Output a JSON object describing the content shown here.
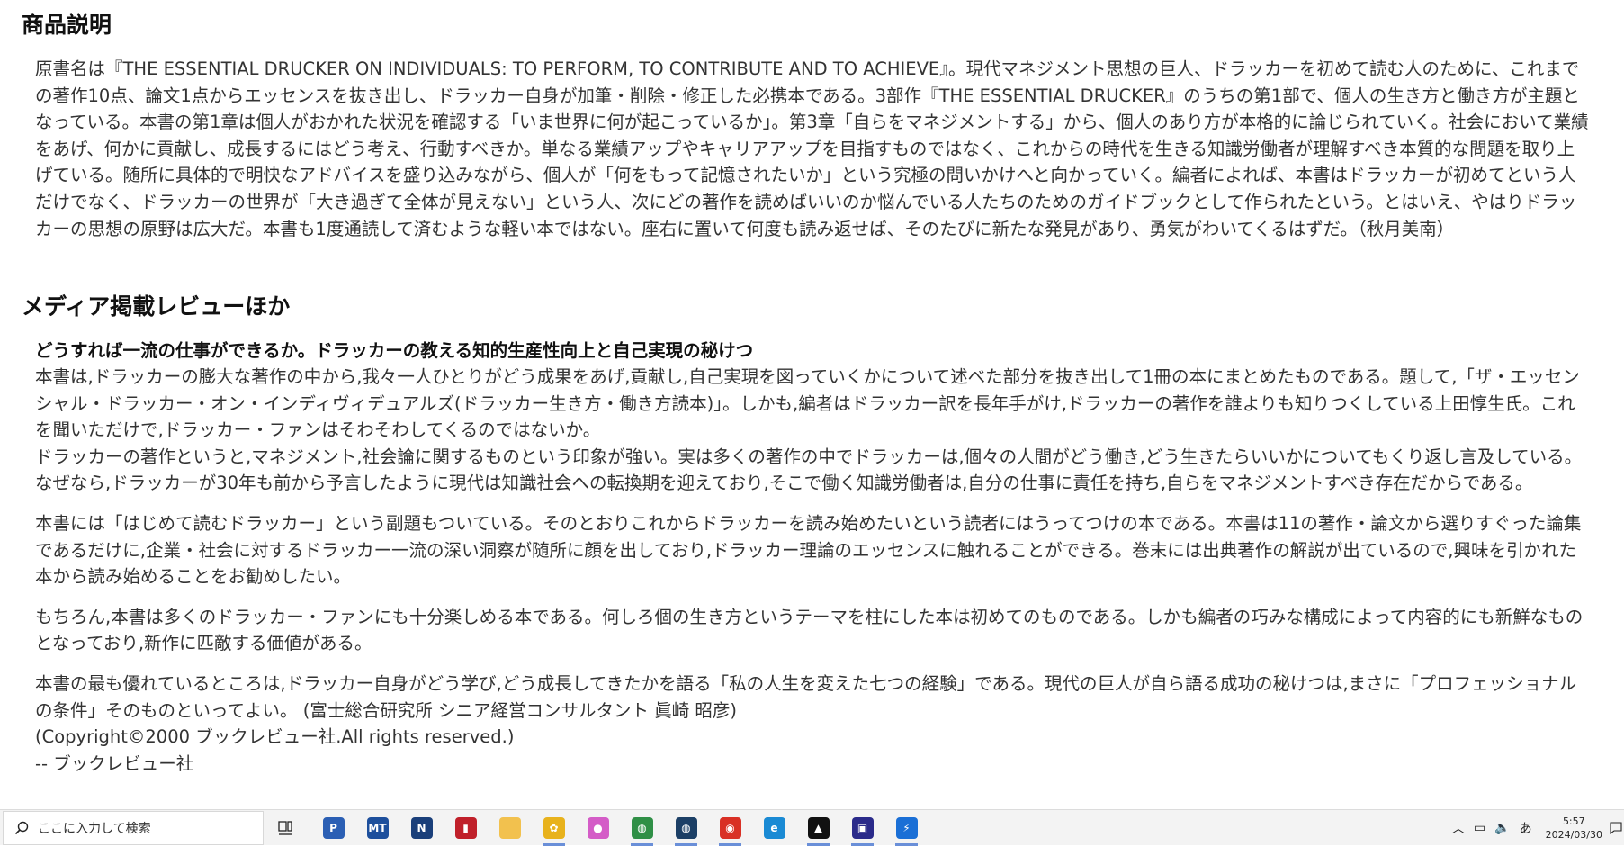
{
  "description": {
    "heading": "商品説明",
    "text": "原書名は『THE ESSENTIAL DRUCKER ON INDIVIDUALS: TO PERFORM, TO CONTRIBUTE AND TO ACHIEVE』。現代マネジメント思想の巨人、ドラッカーを初めて読む人のために、これまでの著作10点、論文1点からエッセンスを抜き出し、ドラッカー自身が加筆・削除・修正した必携本である。3部作『THE ESSENTIAL DRUCKER』のうちの第1部で、個人の生き方と働き方が主題となっている。本書の第1章は個人がおかれた状況を確認する「いま世界に何が起こっているか」。第3章「自らをマネジメントする」から、個人のあり方が本格的に論じられていく。社会において業績をあげ、何かに貢献し、成長するにはどう考え、行動すべきか。単なる業績アップやキャリアアップを目指すものではなく、これからの時代を生きる知識労働者が理解すべき本質的な問題を取り上げている。随所に具体的で明快なアドバイスを盛り込みながら、個人が「何をもって記憶されたいか」という究極の問いかけへと向かっていく。編者によれば、本書はドラッカーが初めてという人だけでなく、ドラッカーの世界が「大き過ぎて全体が見えない」という人、次にどの著作を読めばいいのか悩んでいる人たちのためのガイドブックとして作られたという。とはいえ、やはりドラッカーの思想の原野は広大だ。本書も1度通読して済むような軽い本ではない。座右に置いて何度も読み返せば、そのたびに新たな発見があり、勇気がわいてくるはずだ。（秋月美南）"
  },
  "media": {
    "heading": "メディア掲載レビューほか",
    "review_title": "どうすれば一流の仕事ができるか。ドラッカーの教える知的生産性向上と自己実現の秘けつ",
    "paragraphs": [
      "本書は,ドラッカーの膨大な著作の中から,我々一人ひとりがどう成果をあげ,貢献し,自己実現を図っていくかについて述べた部分を抜き出して1冊の本にまとめたものである。題して,「ザ・エッセンシャル・ドラッカー・オン・インディヴィデュアルズ(ドラッカー生き方・働き方読本)」。しかも,編者はドラッカー訳を長年手がけ,ドラッカーの著作を誰よりも知りつくしている上田惇生氏。これを聞いただけで,ドラッカー・ファンはそわそわしてくるのではないか。",
      "ドラッカーの著作というと,マネジメント,社会論に関するものという印象が強い。実は多くの著作の中でドラッカーは,個々の人間がどう働き,どう生きたらいいかについてもくり返し言及している。なぜなら,ドラッカーが30年も前から予言したように現代は知識社会への転換期を迎えており,そこで働く知識労働者は,自分の仕事に責任を持ち,自らをマネジメントすべき存在だからである。",
      "本書には「はじめて読むドラッカー」という副題もついている。そのとおりこれからドラッカーを読み始めたいという読者にはうってつけの本である。本書は11の著作・論文から選りすぐった論集であるだけに,企業・社会に対するドラッカー一流の深い洞察が随所に顔を出しており,ドラッカー理論のエッセンスに触れることができる。巻末には出典著作の解説が出ているので,興味を引かれた本から読み始めることをお勧めしたい。",
      "もちろん,本書は多くのドラッカー・ファンにも十分楽しめる本である。何しろ個の生き方というテーマを柱にした本は初めてのものである。しかも編者の巧みな構成によって内容的にも新鮮なものとなっており,新作に匹敵する価値がある。",
      "本書の最も優れているところは,ドラッカー自身がどう学び,どう成長してきたかを語る「私の人生を変えた七つの経験」である。現代の巨人が自ら語る成功の秘けつは,まさに「プロフェッショナルの条件」そのものといってよい。 (富士総合研究所 シニア経営コンサルタント 眞崎 昭彦)"
    ],
    "copyright": "(Copyright©2000 ブックレビュー社.All rights reserved.)",
    "source": "-- ブックレビュー社"
  },
  "taskbar": {
    "search_placeholder": "ここに入力して検索",
    "apps": [
      {
        "icon": "p-app-icon",
        "glyph": "P",
        "color": "#2b5fb4",
        "running": false
      },
      {
        "icon": "mt-app-icon",
        "glyph": "MT",
        "color": "#1d4f9c",
        "running": false
      },
      {
        "icon": "n-app-icon",
        "glyph": "N",
        "color": "#1a3f7a",
        "running": false
      },
      {
        "icon": "chart-app-icon",
        "glyph": "▮",
        "color": "#c0202a",
        "running": false
      },
      {
        "icon": "file-explorer-icon",
        "glyph": "",
        "color": "#f2c14e",
        "running": false
      },
      {
        "icon": "sunflower-app-icon",
        "glyph": "✿",
        "color": "#e8b21c",
        "running": true
      },
      {
        "icon": "drop-app-icon",
        "glyph": "●",
        "color": "#d45cc7",
        "running": false
      },
      {
        "icon": "globe-app-icon",
        "glyph": "◍",
        "color": "#2f8f46",
        "running": true
      },
      {
        "icon": "earth-app-icon",
        "glyph": "◍",
        "color": "#1c3f66",
        "running": true
      },
      {
        "icon": "chrome-icon",
        "glyph": "◉",
        "color": "#d93025",
        "running": true
      },
      {
        "icon": "edge-icon",
        "glyph": "e",
        "color": "#1a8ad4",
        "running": false
      },
      {
        "icon": "stock-app-icon",
        "glyph": "▲",
        "color": "#111111",
        "running": true
      },
      {
        "icon": "terminal-app-icon",
        "glyph": "▣",
        "color": "#2a2a8a",
        "running": true
      },
      {
        "icon": "bolt-app-icon",
        "glyph": "⚡",
        "color": "#1a6fd6",
        "running": true
      }
    ],
    "tray": {
      "ime": "あ",
      "time": "5:57",
      "date": "2024/03/30"
    }
  }
}
